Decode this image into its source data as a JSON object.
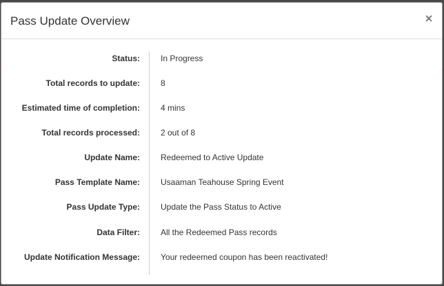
{
  "modal": {
    "title": "Pass Update Overview",
    "close_symbol": "×",
    "close_icon": "close-icon"
  },
  "details": [
    {
      "label": "Status:",
      "value": "In Progress"
    },
    {
      "label": "Total records to update:",
      "value": "8"
    },
    {
      "label": "Estimated time of completion:",
      "value": "4 mins"
    },
    {
      "label": "Total records processed:",
      "value": "2 out of 8"
    },
    {
      "label": "Update Name:",
      "value": "Redeemed to Active Update"
    },
    {
      "label": "Pass Template Name:",
      "value": "Usaaman Teahouse Spring Event"
    },
    {
      "label": "Pass Update Type:",
      "value": "Update the Pass Status to Active"
    },
    {
      "label": "Data Filter:",
      "value": "All the Redeemed Pass records"
    },
    {
      "label": "Update Notification Message:",
      "value": "Your redeemed coupon has been reactivated!"
    }
  ]
}
